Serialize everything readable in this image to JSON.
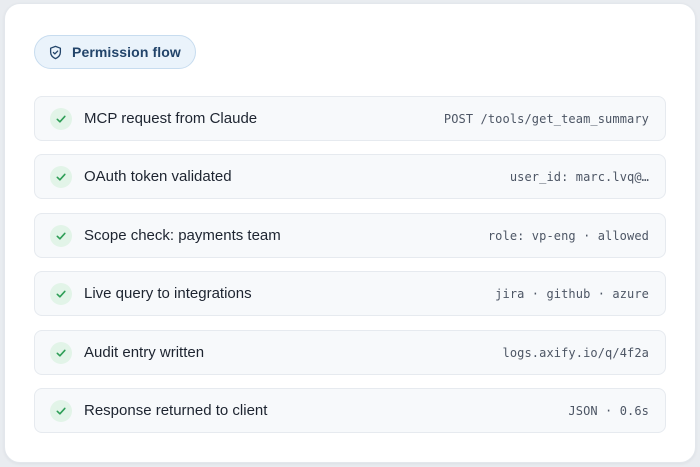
{
  "header": {
    "badge_label": "Permission flow",
    "badge_icon": "shield-icon",
    "accent_color": "#22446a"
  },
  "steps": [
    {
      "title": "MCP request from Claude",
      "detail": "POST /tools/get_team_summary",
      "status": "done",
      "icon": "check-icon"
    },
    {
      "title": "OAuth token validated",
      "detail": "user_id: marc.lvq@…",
      "status": "done",
      "icon": "check-icon"
    },
    {
      "title": "Scope check: payments team",
      "detail": "role: vp-eng · allowed",
      "status": "done",
      "icon": "check-icon"
    },
    {
      "title": "Live query to integrations",
      "detail": "jira · github · azure",
      "status": "done",
      "icon": "check-icon"
    },
    {
      "title": "Audit entry written",
      "detail": "logs.axify.io/q/4f2a",
      "status": "done",
      "icon": "check-icon"
    },
    {
      "title": "Response returned to client",
      "detail": "JSON · 0.6s",
      "status": "done",
      "icon": "check-icon"
    }
  ],
  "colors": {
    "check_green": "#2e9e57",
    "check_bg": "#e2f4e8"
  }
}
